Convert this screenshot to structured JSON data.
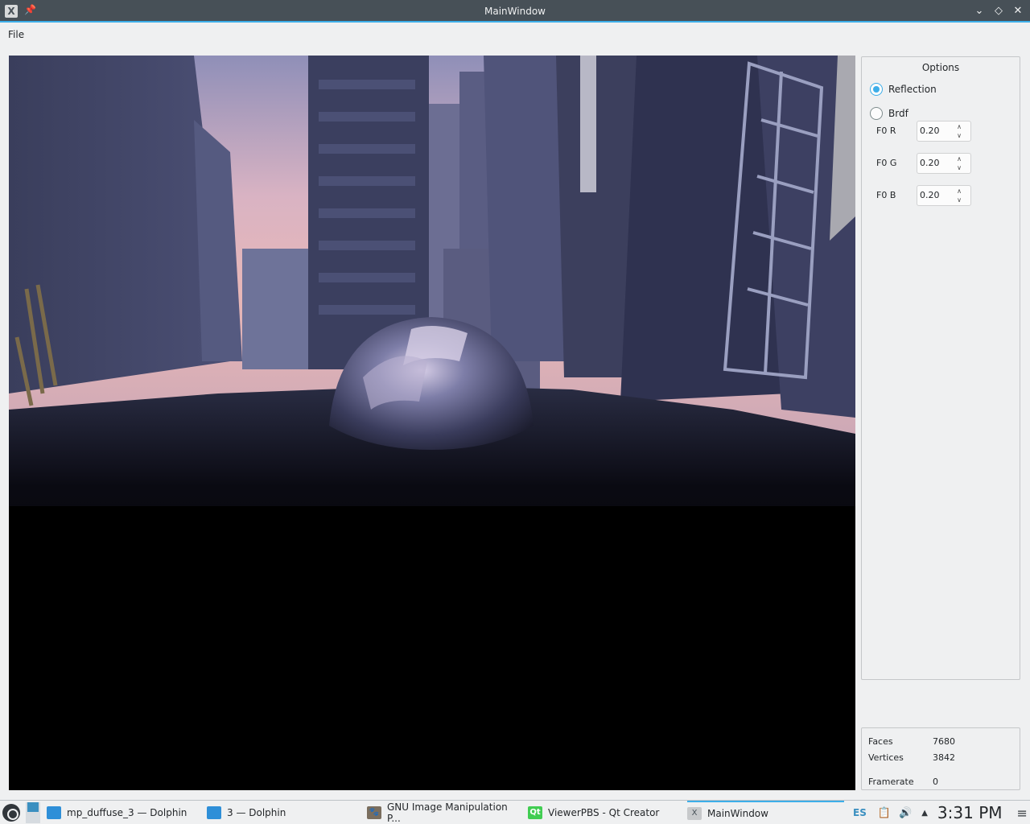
{
  "window": {
    "title": "MainWindow",
    "app_icon": "x-app-icon",
    "pin_icon": "pin-icon",
    "buttons": [
      "minimize",
      "maximize",
      "close"
    ]
  },
  "menubar": {
    "file": "File"
  },
  "options": {
    "title": "Options",
    "reflection_label": "Reflection",
    "reflection_checked": true,
    "brdf_label": "Brdf",
    "brdf_checked": false,
    "f0r_label": "F0 R",
    "f0r_value": "0.20",
    "f0g_label": "F0 G",
    "f0g_value": "0.20",
    "f0b_label": "F0 B",
    "f0b_value": "0.20"
  },
  "stats": {
    "faces_label": "Faces",
    "faces_value": "7680",
    "vertices_label": "Vertices",
    "vertices_value": "3842",
    "framerate_label": "Framerate",
    "framerate_value": "0"
  },
  "taskbar": {
    "tasks": [
      {
        "label": "mp_duffuse_3 — Dolphin",
        "icon": "folder-icon"
      },
      {
        "label": "3 — Dolphin",
        "icon": "folder-icon"
      },
      {
        "label": "GNU Image Manipulation P...",
        "icon": "gimp-icon"
      },
      {
        "label": "ViewerPBS - Qt Creator",
        "icon": "qt-icon"
      },
      {
        "label": "MainWindow",
        "icon": "x-app-icon"
      }
    ],
    "keyboard_layout": "ES",
    "clock": "3:31 PM"
  },
  "colors": {
    "accent": "#3daee9",
    "titlebar": "#475057",
    "window_bg": "#eff0f1"
  }
}
